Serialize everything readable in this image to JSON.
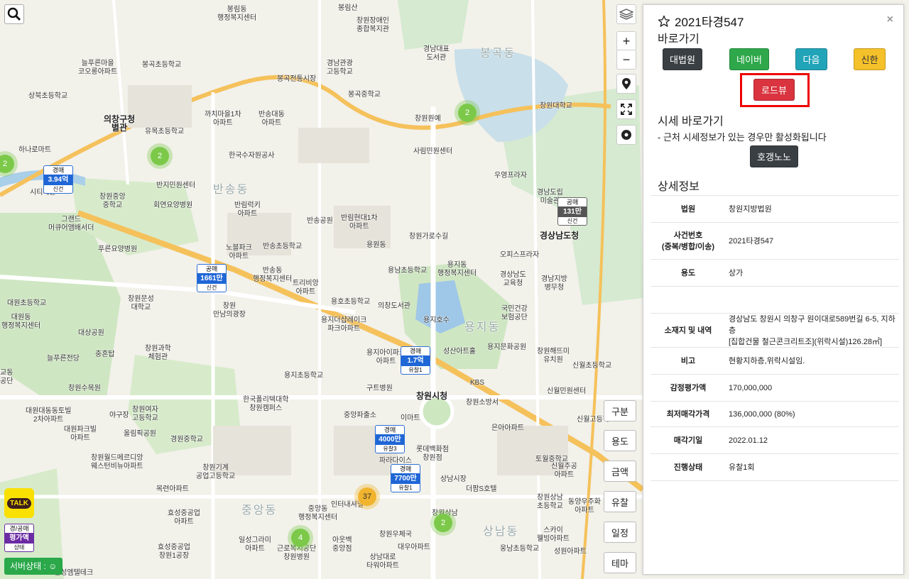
{
  "map": {
    "clusters": [
      {
        "label": "2"
      },
      {
        "label": "2"
      },
      {
        "label": "2"
      },
      {
        "label": "37"
      },
      {
        "label": "4"
      },
      {
        "label": "2"
      }
    ],
    "markers": [
      {
        "type": "경매",
        "value": "3.94억",
        "sub": "신건"
      },
      {
        "type": "공매",
        "value": "131만",
        "sub": "신건"
      },
      {
        "type": "공매",
        "value": "1661만",
        "sub": "신건"
      },
      {
        "type": "경매",
        "value": "1.7억",
        "sub": "유찰1"
      },
      {
        "type": "경매",
        "value": "4000만",
        "sub": "유찰3"
      },
      {
        "type": "경매",
        "value": "7700만",
        "sub": "유찰1"
      },
      {
        "type": "경/공매",
        "value": "평가액",
        "sub": "상태"
      }
    ],
    "labels": {
      "l1": "봉림동\n행정복지센터",
      "l2": "봉림산",
      "l3": "창원장애인\n종합복지관",
      "l4": "경남대표\n도서관",
      "l5": "경남관광\n고등학교",
      "l6": "봉곡전통시장",
      "l7": "봉곡중학교",
      "l8": "늘푸른마을\n코오롱아파트",
      "l9": "봉곡초등학교",
      "l10": "상북초등학교",
      "l11": "의창구청\n별관",
      "l12": "유목초등학교",
      "l13": "하나로마트",
      "l14": "까치마을1차\n아파트",
      "l15": "반송대동\n아파트",
      "l16": "창원원예",
      "l17": "한국수자원공사",
      "l18": "사림민원센터",
      "l19": "우영프라자",
      "l20": "창원대학교",
      "l21": "반지민원센터",
      "l22": "시티세븐",
      "l23": "창원중앙\n중학교",
      "l24": "회연요양병원",
      "l25": "그랜드\n머큐어앰배서더",
      "l26": "반림럭키\n아파트",
      "l27": "반송공원",
      "l28": "반림현대1차\n아파트",
      "l29": "경남도립\n미술관",
      "l30": "경상남도청",
      "l31": "푸른요양병원",
      "l32": "창원가로수길",
      "l33": "노블파크\n아파트",
      "l34": "반송초등학교",
      "l35": "용원동",
      "l36": "오피스프라자",
      "l37": "반송동\n행정복지센터",
      "l38": "용남초등학교",
      "l39": "용지동\n행정복지센터",
      "l40": "경상남도\n교육청",
      "l41": "경남지방\n병무청",
      "l42": "창원문성\n대학교",
      "l43": "트리비앙\n아파트",
      "l44": "창원\n만남의광장",
      "l45": "용호초등학교",
      "l46": "의창도서관",
      "l47": "용지호수",
      "l48": "국민건강\n보험공단",
      "l49": "대원초등학교",
      "l50": "대원동\n행정복지센터",
      "l51": "용지더샵레이크\n파크아파트",
      "l52": "용지동",
      "l53": "용지문화공원",
      "l54": "대상공원",
      "l55": "창원과학\n체험관",
      "l56": "용지아이파크\n아파트",
      "l57": "성산아트홀",
      "l58": "창원해뜨미\n유치원",
      "l59": "신월초등학교",
      "l60": "늘푸른전당",
      "l61": "충혼탑",
      "l62": "용지초등학교",
      "l63": "KBS",
      "l64": "교동\n공단",
      "l65": "창원수목원",
      "l66": "구트병원",
      "l67": "창원시청",
      "l68": "신월민원센터",
      "l69": "한국폴리텍대학\n창원캠퍼스",
      "l70": "창원소방서",
      "l71": "대원대동동토빌\n2차아파트",
      "l72": "야구장",
      "l73": "창원여자\n고등학교",
      "l74": "중앙파출소",
      "l75": "이마트",
      "l76": "신월고등학교",
      "l77": "대원파크빌\n아파트",
      "l78": "올림픽공원",
      "l79": "은아아파트",
      "l80": "경원중학교",
      "l81": "창원월드메르디앙\n웨스턴비뉴아파트",
      "l82": "롯데백화점\n창원점",
      "l83": "토월중학교",
      "l84": "창원기계\n공업고등학교",
      "l85": "파라다이스",
      "l86": "상남시장",
      "l87": "신월주공\n아파트",
      "l88": "목련아파트",
      "l89": "더팜S호텔",
      "l90": "창원상남\n초등학교",
      "l91": "인터내셔널",
      "l92": "효성중공업\n아파트",
      "l93": "중앙동",
      "l94": "중앙동\n행정복지센터",
      "l95": "창원상남\n분수",
      "l96": "동양우주화\n아파트",
      "l97": "일성그라미\n아파트",
      "l98": "아웃백\n중앙점",
      "l99": "창원우체국",
      "l100": "스카이\n웰빙아파트",
      "l101": "효성중공업\n창원1공장",
      "l102": "근로복지공단\n창원병원",
      "l103": "대우아파트",
      "l104": "상남대로\n타워아파트",
      "l105": "웅남초등학교",
      "l106": "성원아파트",
      "l107": "상남동",
      "l108": "인성엠텔테크",
      "l109": "봉곡동",
      "l110": "반송동"
    },
    "controls": {
      "zoom_in": "+",
      "zoom_out": "−"
    },
    "filters": [
      "구분",
      "용도",
      "금액",
      "유찰",
      "일정",
      "테마"
    ],
    "talk": "TALK",
    "server_status": "서버상태 : ☺"
  },
  "panel": {
    "case_title": "2021타경547",
    "close": "×",
    "goto_heading": "바로가기",
    "goto_buttons": [
      {
        "label": "대법원",
        "color": "#3a3f44"
      },
      {
        "label": "네이버",
        "color": "#2ea84a"
      },
      {
        "label": "다음",
        "color": "#22a4b8"
      },
      {
        "label": "신한",
        "color": "#f5c12a"
      }
    ],
    "roadview": {
      "label": "로드뷰",
      "color": "#d9343f"
    },
    "price_heading": "시세 바로가기",
    "price_note": "- 근처 시세정보가 있는 경우만 활성화됩니다",
    "hogang_label": "호갱노노",
    "detail_heading": "상세정보",
    "details": [
      {
        "key": "법원",
        "value": "창원지방법원"
      },
      {
        "key": "사건번호\n(중복/병합/이송)",
        "value": "2021타경547"
      },
      {
        "key": "용도",
        "value": "상가"
      },
      {
        "key": "소재지 및 내역",
        "value": "경상남도 창원시 의창구 원이대로589번길 6-5, 지하층\n[집합건물 철근콘크리트조](위락시설)126.28㎡]"
      },
      {
        "key": "비고",
        "value": "현황지하층,위락시설임."
      },
      {
        "key": "감정평가액",
        "value": "170,000,000"
      },
      {
        "key": "최저매각가격",
        "value": "136,000,000 (80%)"
      },
      {
        "key": "매각기일",
        "value": "2022.01.12"
      },
      {
        "key": "진행상태",
        "value": "유찰1회"
      }
    ]
  }
}
